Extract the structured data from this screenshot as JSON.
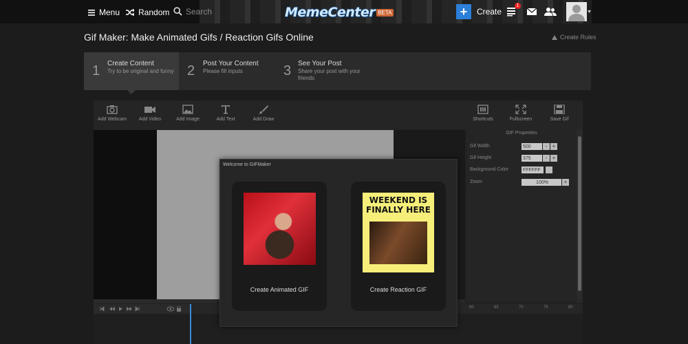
{
  "topbar": {
    "menu_label": "Menu",
    "random_label": "Random",
    "search_placeholder": "Search",
    "logo_text": "MemeCenter",
    "logo_tag": "BETA",
    "create_label": "Create",
    "notification_count": "1",
    "icons": [
      "menu-icon",
      "shuffle-icon",
      "search-icon",
      "plus-icon",
      "list-icon",
      "mail-icon",
      "users-icon",
      "avatar"
    ]
  },
  "page": {
    "title": "Gif Maker: Make Animated Gifs / Reaction Gifs Online",
    "create_rules": "Create Rules"
  },
  "steps": [
    {
      "num": "1",
      "title": "Create Content",
      "sub": "Try to be original and funny"
    },
    {
      "num": "2",
      "title": "Post Your Content",
      "sub": "Please fill inputs"
    },
    {
      "num": "3",
      "title": "See Your Post",
      "sub": "Share your post with your friends"
    }
  ],
  "toolbar": {
    "left_tools": [
      "Add Webcam",
      "Add Video",
      "Add Image",
      "Add Text",
      "Add Draw"
    ],
    "right_tools": [
      "Shortcuts",
      "Fullscreen",
      "Save Gif"
    ]
  },
  "properties": {
    "title": "GIF Properties",
    "width_label": "Gif Width",
    "width_value": "500",
    "height_label": "Gif Height",
    "height_value": "375",
    "bg_label": "Background Color",
    "bg_value": "FFFFFF",
    "zoom_label": "Zoom",
    "zoom_value": "100%"
  },
  "timeline": {
    "ruler_ticks": [
      "60",
      "65",
      "70",
      "75",
      "80"
    ]
  },
  "modal": {
    "title": "Welcome to GIFMaker",
    "card1_label": "Create Animated GIF",
    "card2_label": "Create Reaction GIF",
    "card2_caption": "WEEKEND IS FINALLY HERE"
  },
  "colors": {
    "accent": "#2b7fd8",
    "badge": "#ee2222",
    "background": "#1c1c1c"
  }
}
